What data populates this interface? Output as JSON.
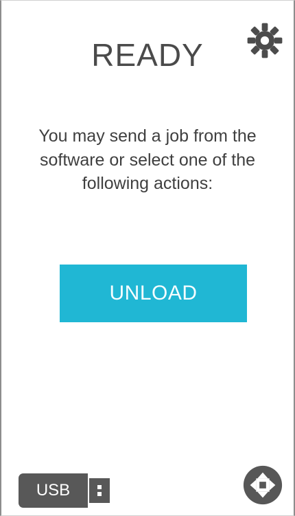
{
  "screen": {
    "title": "READY",
    "message": "You may send a job from the software or select one of the following actions:",
    "accent_color": "#20b7d4"
  },
  "actions": {
    "unload_label": "UNLOAD"
  },
  "status": {
    "usb_label": "USB"
  },
  "icons": {
    "settings": "gear-icon",
    "usb": "usb-icon",
    "move": "directional-pad-icon"
  }
}
